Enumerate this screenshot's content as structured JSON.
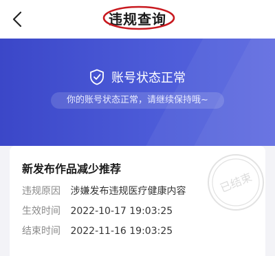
{
  "header": {
    "title": "违规查询"
  },
  "banner": {
    "status_text": "账号状态正常",
    "sub_text": "你的账号状态正常，请继续保持哦~"
  },
  "card": {
    "title": "新发布作品减少推荐",
    "rows": [
      {
        "label": "违规原因",
        "value": "涉嫌发布违规医疗健康内容"
      },
      {
        "label": "生效时间",
        "value": "2022-10-17 19:03:25"
      },
      {
        "label": "结束时间",
        "value": "2022-11-16 19:03:25"
      }
    ],
    "stamp_text": "已结束"
  },
  "colors": {
    "banner": "#4450d0",
    "annotation": "#c8181e",
    "accent_text": "#ffffff"
  },
  "icons": {
    "back": "chevron-left-icon",
    "status": "shield-check-icon",
    "stamp": "ended-stamp-icon"
  }
}
